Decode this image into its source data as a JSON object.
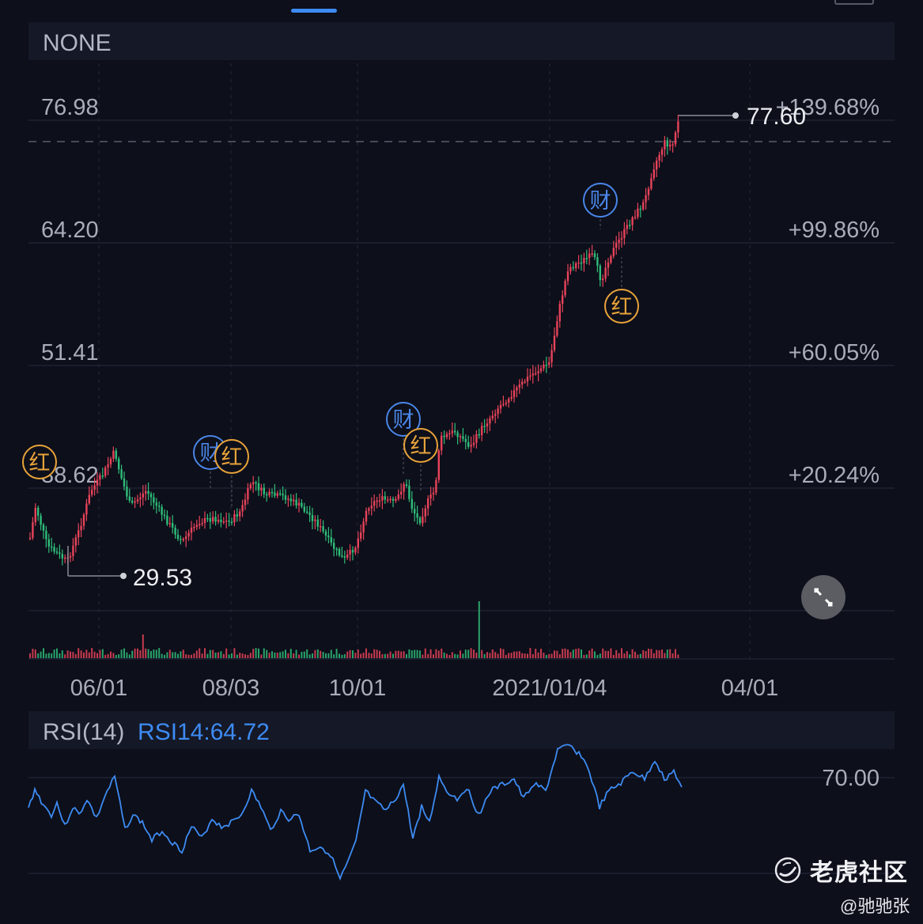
{
  "main_chart": {
    "indicator_label": "NONE",
    "y_axis_left": [
      "76.98",
      "64.20",
      "51.41",
      "38.62"
    ],
    "y_axis_right": [
      "+139.68%",
      "+99.86%",
      "+60.05%",
      "+20.24%"
    ],
    "x_axis": [
      "06/01",
      "08/03",
      "10/01",
      "2021/01/04",
      "04/01"
    ],
    "high_label": "77.60",
    "low_label": "29.53",
    "markers": [
      {
        "text": "红",
        "kind": "dividend"
      },
      {
        "text": "财",
        "kind": "earnings"
      },
      {
        "text": "红",
        "kind": "dividend"
      },
      {
        "text": "财",
        "kind": "earnings"
      },
      {
        "text": "红",
        "kind": "dividend"
      },
      {
        "text": "财",
        "kind": "earnings"
      },
      {
        "text": "红",
        "kind": "dividend"
      }
    ]
  },
  "rsi_panel": {
    "label": "RSI(14)",
    "value_label": "RSI14:64.72",
    "level_label": "70.00"
  },
  "watermark": {
    "brand": "老虎社区",
    "user": "@驰驰张"
  },
  "colors": {
    "background": "#0d0f1a",
    "header_band": "#151827",
    "up_candle": "#e8435a",
    "down_candle": "#2fbd7a",
    "rsi_line": "#3d8bf2",
    "earnings_marker": "#4a86e8",
    "dividend_marker": "#e8a33a"
  },
  "icons": [
    "fullscreen-collapse-icon",
    "tiger-logo-icon"
  ]
}
